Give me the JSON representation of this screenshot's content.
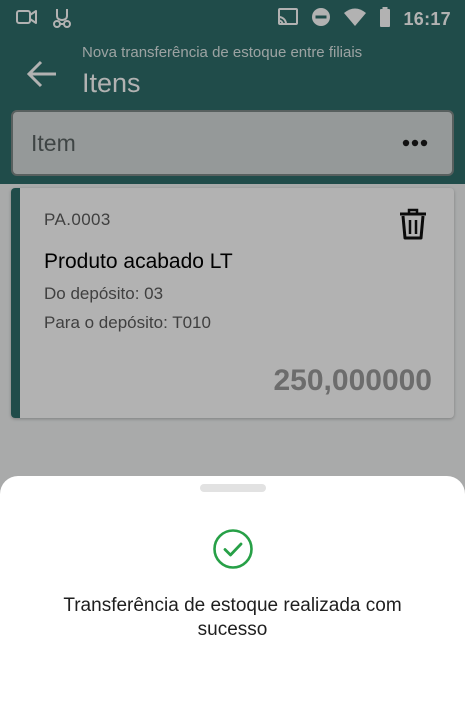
{
  "status_bar": {
    "time": "16:17",
    "left_icons": [
      "video-camera-icon",
      "voicemail-icon"
    ],
    "right_icons": [
      "cast-icon",
      "do-not-disturb-icon",
      "wifi-icon",
      "battery-icon"
    ]
  },
  "header": {
    "subtitle": "Nova transferência de estoque entre filiais",
    "title": "Itens",
    "back_icon": "arrow-left-icon"
  },
  "search": {
    "placeholder": "Item",
    "more_icon": "more-horizontal-icon"
  },
  "item_card": {
    "code": "PA.0003",
    "name": "Produto acabado LT",
    "from_depot": "Do depósito: 03",
    "to_depot": "Para o depósito: T010",
    "quantity": "250,000000",
    "delete_icon": "trash-icon"
  },
  "bottom_sheet": {
    "icon": "check-circle-icon",
    "message": "Transferência de estoque realizada com sucesso"
  },
  "colors": {
    "primary": "#2e6e6a",
    "success": "#27a047",
    "scrim": "#000000"
  }
}
